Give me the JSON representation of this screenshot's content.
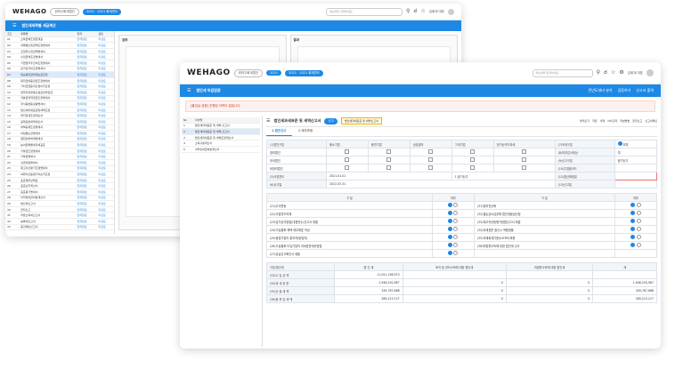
{
  "back": {
    "logo": "WEHAGO",
    "company": "위하고회계법인",
    "menu_pill": "2021 · 2021 회계연도",
    "title": "법인세세목별 세금계산",
    "search_placeholder": "메뉴명을 입력하세요",
    "user": "김회계 대표",
    "list_header": [
      "코드",
      "세목명",
      "입력",
      "검토"
    ],
    "rows": [
      {
        "code": "01",
        "name": "소득금액조정합계표",
        "a": "입력완료",
        "b": "미검토"
      },
      {
        "code": "02",
        "name": "과목별소득금액조정명세서",
        "a": "입력완료",
        "b": "미검토"
      },
      {
        "code": "03",
        "name": "조정후수입금액명세서",
        "a": "입력완료",
        "b": "미검토"
      },
      {
        "code": "04",
        "name": "수입금액조정명세서",
        "a": "입력완료",
        "b": "미검토"
      },
      {
        "code": "05",
        "name": "기업업무추진비조정명세서",
        "a": "입력완료",
        "b": "미검토"
      },
      {
        "code": "06",
        "name": "감가상각비조정명세서",
        "a": "입력완료",
        "b": "미검토"
      },
      {
        "code": "07",
        "name": "대손충당금및대손금조정",
        "a": "입력완료",
        "b": "미검토"
      },
      {
        "code": "08",
        "name": "퇴직급여충당금조정명세서",
        "a": "입력완료",
        "b": "미검토"
      },
      {
        "code": "09",
        "name": "가지급금등의인정이자조정",
        "a": "입력완료",
        "b": "미검토"
      },
      {
        "code": "10",
        "name": "업무무관부동산등관련차입금",
        "a": "입력완료",
        "b": "미검토"
      },
      {
        "code": "11",
        "name": "자본금과적립금조정명세서",
        "a": "입력완료",
        "b": "미검토"
      },
      {
        "code": "12",
        "name": "주식등변동상황명세서",
        "a": "입력완료",
        "b": "미검토"
      },
      {
        "code": "13",
        "name": "법인세과세표준및세액조정",
        "a": "입력완료",
        "b": "미검토"
      },
      {
        "code": "14",
        "name": "최저한세조정계산서",
        "a": "입력완료",
        "b": "미검토"
      },
      {
        "code": "15",
        "name": "공제감면세액계산서",
        "a": "입력완료",
        "b": "미검토"
      },
      {
        "code": "16",
        "name": "세액공제조정명세서",
        "a": "입력완료",
        "b": "미검토"
      },
      {
        "code": "17",
        "name": "이월결손금명세서",
        "a": "입력완료",
        "b": "미검토"
      },
      {
        "code": "18",
        "name": "원천납부세액명세서",
        "a": "입력완료",
        "b": "미검토"
      },
      {
        "code": "19",
        "name": "농어촌특별세과세표준",
        "a": "입력완료",
        "b": "미검토"
      },
      {
        "code": "20",
        "name": "기부금조정명세서",
        "a": "입력완료",
        "b": "미검토"
      },
      {
        "code": "21",
        "name": "기부금명세서",
        "a": "입력완료",
        "b": "미검토"
      },
      {
        "code": "22",
        "name": "선급비용명세서",
        "a": "입력완료",
        "b": "미검토"
      },
      {
        "code": "23",
        "name": "재고자산평가조정명세서",
        "a": "입력완료",
        "b": "미검토"
      },
      {
        "code": "24",
        "name": "외화자산등평가차손익조정",
        "a": "입력완료",
        "b": "미검토"
      },
      {
        "code": "25",
        "name": "표준재무상태표",
        "a": "입력완료",
        "b": "미검토"
      },
      {
        "code": "26",
        "name": "표준손익계산서",
        "a": "입력완료",
        "b": "미검토"
      },
      {
        "code": "27",
        "name": "표준원가명세서",
        "a": "입력완료",
        "b": "미검토"
      },
      {
        "code": "28",
        "name": "이익잉여금처분계산서",
        "a": "입력완료",
        "b": "미검토"
      },
      {
        "code": "29",
        "name": "법인세신고서",
        "a": "입력완료",
        "b": "미검토"
      },
      {
        "code": "30",
        "name": "전자신고",
        "a": "입력완료",
        "b": "미검토"
      },
      {
        "code": "31",
        "name": "지방소득세신고서",
        "a": "입력완료",
        "b": "미검토"
      },
      {
        "code": "32",
        "name": "농특세신고서",
        "a": "입력완료",
        "b": "미검토"
      },
      {
        "code": "33",
        "name": "중간예납신고서",
        "a": "입력완료",
        "b": "미검토"
      }
    ],
    "panel1_title": "검토",
    "panel2_title": "결과"
  },
  "front": {
    "logo": "WEHAGO",
    "company": "위하고회계법인",
    "badge1": "2021",
    "badge2": "2021 · 2021 회계연도",
    "search_placeholder": "메뉴명을 입력하세요",
    "user": "김회계 대표",
    "app_title": "법인세 마감검증",
    "app_actions": [
      "전년도대비 분석",
      "검증하기",
      "신고서 출력"
    ],
    "notice": "[불성실 검증] 진행된 이력이 없습니다.",
    "nav_header": [
      "No",
      "서식명"
    ],
    "nav_items": [
      {
        "no": "1",
        "name": "법인세과세표준 및 세액 신고서"
      },
      {
        "no": "2",
        "name": "법인세과세표준 및 세액 신고서"
      },
      {
        "no": "3",
        "name": "법인세과세표준 및 세액조정계산서"
      },
      {
        "no": "4",
        "name": "소득구분계산서"
      },
      {
        "no": "5",
        "name": "이익잉여금처분계산서"
      }
    ],
    "form_title": "법인세과세표준 및 세액신고서",
    "form_tag": "신고",
    "form_chip": "법인세과세표준 및 세액신고서",
    "toolbar_btns": [
      "불러오기",
      "저장",
      "삭제",
      "서식출력",
      "작성방법",
      "전자신고",
      "신고서확인"
    ],
    "tabs": [
      "1.법인신고",
      "2.세무조정"
    ],
    "corp_cols": [
      "중소기업",
      "중견기업",
      "상호출자",
      "그외기업",
      "당기순이익과세"
    ],
    "corp_rows": [
      "영리법인",
      "외국법인",
      "비영리법인"
    ],
    "left_fields": [
      {
        "label": "(1)법인구분",
        "v": ""
      },
      {
        "label": "(2)종류별구분",
        "v": ""
      },
      {
        "label": "(3)사업연도",
        "v": "2021.01.01"
      },
      {
        "label": "(4)수시부과기간",
        "v": ""
      },
      {
        "label": "(5)신고구분",
        "v": "1.정기신고"
      },
      {
        "label": "(6)신고일",
        "v": "2022.03.31"
      }
    ],
    "right_fields": [
      {
        "label": "(7)조정구분",
        "v": "외부"
      },
      {
        "label": "(8)외부감사대상",
        "v": "여"
      },
      {
        "label": "(9)신고구분",
        "v": "정기신고"
      },
      {
        "label": "(10)주업종코드",
        "v": ""
      },
      {
        "label": "(11)사업연도의제",
        "v": ""
      },
      {
        "label": "(12)결산확정일",
        "v": ""
      },
      {
        "label": "(13)신고일",
        "v": ""
      }
    ],
    "yn_header": [
      "구 분",
      "여부",
      "구 분",
      "여부"
    ],
    "yn_rows": [
      {
        "l": "(21)주식변동",
        "r": "(31)장부전산화"
      },
      {
        "l": "(22)사업연도의제",
        "r": "(32)결손금소급공제 법인세환급신청"
      },
      {
        "l": "(23)감가상각방법(내용연수)신고서 제출",
        "r": "(33)재고자산등평가방법신고서 제출"
      },
      {
        "l": "(24)기능통화 채택 재무제표 작성",
        "r": "(34)과세표준 환산시 적용환율"
      },
      {
        "l": "(25)동업기업의 출자자(동업자)",
        "r": "(35)국제회계기준(K-IFRS)적용"
      },
      {
        "l": "(26)기능통화 도입기업의 과세표준계산방법",
        "r": "(36)미환류소득에 대한 법인세 신고"
      },
      {
        "l": "(27)성실신고확인서 제출",
        "r": ""
      }
    ],
    "tax_header": [
      "구분/법인세",
      "법 인 세",
      "토지 등 양도소득에 대한 법인세",
      "미환류소득에 대한 법인세",
      "계"
    ],
    "tax_rows": [
      {
        "label": "(33)수 입 금 액",
        "a": "11,051,196,970",
        "b": "",
        "c": "",
        "d": ""
      },
      {
        "label": "(34)과 세 표 준",
        "a": "1,946,250,987",
        "b": "0",
        "c": "0",
        "d": "1,946,250,987"
      },
      {
        "label": "(35)산 출 세 액",
        "a": "349,787,688",
        "b": "0",
        "c": "0",
        "d": "349,787,688"
      },
      {
        "label": "(36)총 부 담 세 액",
        "a": "289,213,127",
        "b": "0",
        "c": "0",
        "d": "289,213,127"
      }
    ]
  }
}
